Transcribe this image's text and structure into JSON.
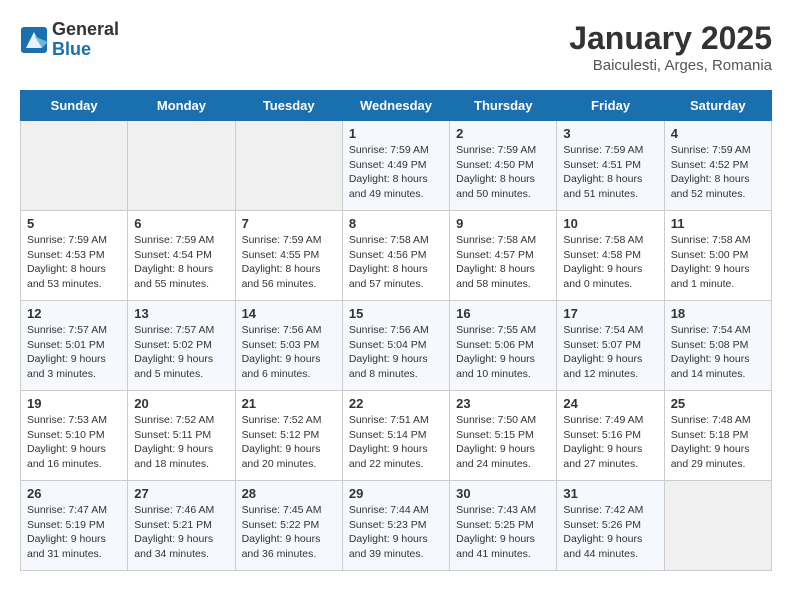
{
  "header": {
    "logo_line1": "General",
    "logo_line2": "Blue",
    "month": "January 2025",
    "location": "Baiculesti, Arges, Romania"
  },
  "weekdays": [
    "Sunday",
    "Monday",
    "Tuesday",
    "Wednesday",
    "Thursday",
    "Friday",
    "Saturday"
  ],
  "weeks": [
    [
      {
        "day": "",
        "info": ""
      },
      {
        "day": "",
        "info": ""
      },
      {
        "day": "",
        "info": ""
      },
      {
        "day": "1",
        "info": "Sunrise: 7:59 AM\nSunset: 4:49 PM\nDaylight: 8 hours\nand 49 minutes."
      },
      {
        "day": "2",
        "info": "Sunrise: 7:59 AM\nSunset: 4:50 PM\nDaylight: 8 hours\nand 50 minutes."
      },
      {
        "day": "3",
        "info": "Sunrise: 7:59 AM\nSunset: 4:51 PM\nDaylight: 8 hours\nand 51 minutes."
      },
      {
        "day": "4",
        "info": "Sunrise: 7:59 AM\nSunset: 4:52 PM\nDaylight: 8 hours\nand 52 minutes."
      }
    ],
    [
      {
        "day": "5",
        "info": "Sunrise: 7:59 AM\nSunset: 4:53 PM\nDaylight: 8 hours\nand 53 minutes."
      },
      {
        "day": "6",
        "info": "Sunrise: 7:59 AM\nSunset: 4:54 PM\nDaylight: 8 hours\nand 55 minutes."
      },
      {
        "day": "7",
        "info": "Sunrise: 7:59 AM\nSunset: 4:55 PM\nDaylight: 8 hours\nand 56 minutes."
      },
      {
        "day": "8",
        "info": "Sunrise: 7:58 AM\nSunset: 4:56 PM\nDaylight: 8 hours\nand 57 minutes."
      },
      {
        "day": "9",
        "info": "Sunrise: 7:58 AM\nSunset: 4:57 PM\nDaylight: 8 hours\nand 58 minutes."
      },
      {
        "day": "10",
        "info": "Sunrise: 7:58 AM\nSunset: 4:58 PM\nDaylight: 9 hours\nand 0 minutes."
      },
      {
        "day": "11",
        "info": "Sunrise: 7:58 AM\nSunset: 5:00 PM\nDaylight: 9 hours\nand 1 minute."
      }
    ],
    [
      {
        "day": "12",
        "info": "Sunrise: 7:57 AM\nSunset: 5:01 PM\nDaylight: 9 hours\nand 3 minutes."
      },
      {
        "day": "13",
        "info": "Sunrise: 7:57 AM\nSunset: 5:02 PM\nDaylight: 9 hours\nand 5 minutes."
      },
      {
        "day": "14",
        "info": "Sunrise: 7:56 AM\nSunset: 5:03 PM\nDaylight: 9 hours\nand 6 minutes."
      },
      {
        "day": "15",
        "info": "Sunrise: 7:56 AM\nSunset: 5:04 PM\nDaylight: 9 hours\nand 8 minutes."
      },
      {
        "day": "16",
        "info": "Sunrise: 7:55 AM\nSunset: 5:06 PM\nDaylight: 9 hours\nand 10 minutes."
      },
      {
        "day": "17",
        "info": "Sunrise: 7:54 AM\nSunset: 5:07 PM\nDaylight: 9 hours\nand 12 minutes."
      },
      {
        "day": "18",
        "info": "Sunrise: 7:54 AM\nSunset: 5:08 PM\nDaylight: 9 hours\nand 14 minutes."
      }
    ],
    [
      {
        "day": "19",
        "info": "Sunrise: 7:53 AM\nSunset: 5:10 PM\nDaylight: 9 hours\nand 16 minutes."
      },
      {
        "day": "20",
        "info": "Sunrise: 7:52 AM\nSunset: 5:11 PM\nDaylight: 9 hours\nand 18 minutes."
      },
      {
        "day": "21",
        "info": "Sunrise: 7:52 AM\nSunset: 5:12 PM\nDaylight: 9 hours\nand 20 minutes."
      },
      {
        "day": "22",
        "info": "Sunrise: 7:51 AM\nSunset: 5:14 PM\nDaylight: 9 hours\nand 22 minutes."
      },
      {
        "day": "23",
        "info": "Sunrise: 7:50 AM\nSunset: 5:15 PM\nDaylight: 9 hours\nand 24 minutes."
      },
      {
        "day": "24",
        "info": "Sunrise: 7:49 AM\nSunset: 5:16 PM\nDaylight: 9 hours\nand 27 minutes."
      },
      {
        "day": "25",
        "info": "Sunrise: 7:48 AM\nSunset: 5:18 PM\nDaylight: 9 hours\nand 29 minutes."
      }
    ],
    [
      {
        "day": "26",
        "info": "Sunrise: 7:47 AM\nSunset: 5:19 PM\nDaylight: 9 hours\nand 31 minutes."
      },
      {
        "day": "27",
        "info": "Sunrise: 7:46 AM\nSunset: 5:21 PM\nDaylight: 9 hours\nand 34 minutes."
      },
      {
        "day": "28",
        "info": "Sunrise: 7:45 AM\nSunset: 5:22 PM\nDaylight: 9 hours\nand 36 minutes."
      },
      {
        "day": "29",
        "info": "Sunrise: 7:44 AM\nSunset: 5:23 PM\nDaylight: 9 hours\nand 39 minutes."
      },
      {
        "day": "30",
        "info": "Sunrise: 7:43 AM\nSunset: 5:25 PM\nDaylight: 9 hours\nand 41 minutes."
      },
      {
        "day": "31",
        "info": "Sunrise: 7:42 AM\nSunset: 5:26 PM\nDaylight: 9 hours\nand 44 minutes."
      },
      {
        "day": "",
        "info": ""
      }
    ]
  ]
}
